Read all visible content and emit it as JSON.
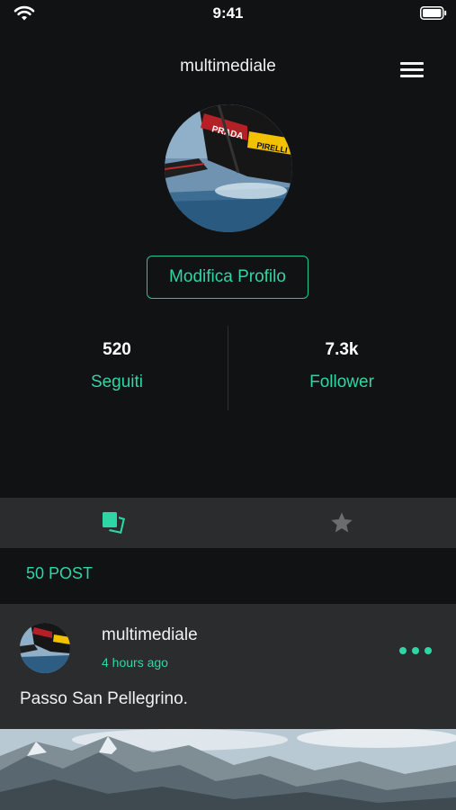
{
  "status_bar": {
    "time": "9:41",
    "icons": [
      "wifi-icon",
      "battery-icon"
    ]
  },
  "header": {
    "title": "multimediale",
    "menu_icon": "hamburger-menu-icon"
  },
  "profile": {
    "avatar": "sailboat-photo",
    "edit_button_label": "Modifica Profilo",
    "stats": [
      {
        "value": "520",
        "label": "Seguiti"
      },
      {
        "value": "7.3k",
        "label": "Follower"
      }
    ]
  },
  "tabs": [
    {
      "icon": "posts-grid-icon",
      "active": true
    },
    {
      "icon": "star-icon",
      "active": false
    }
  ],
  "posts_count_label": "50 POST",
  "post": {
    "username": "multimediale",
    "time": "4 hours ago",
    "text": "Passo San Pellegrino.",
    "more_icon": "more-dots-icon",
    "image": "mountain-landscape-photo"
  },
  "colors": {
    "accent": "#2fd6a5",
    "background": "#111213",
    "surface": "#2a2c2e"
  }
}
